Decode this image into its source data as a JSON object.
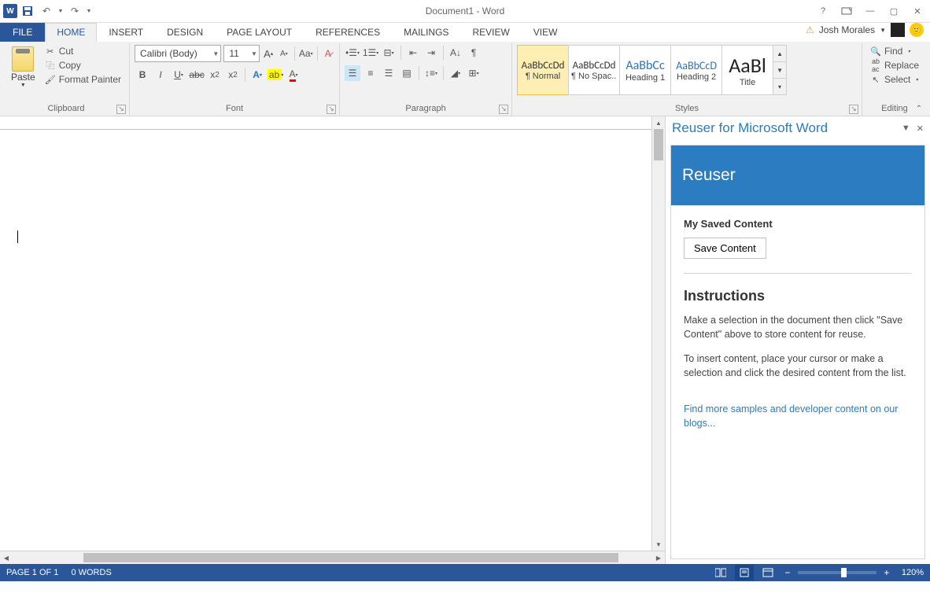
{
  "title": "Document1 - Word",
  "user": {
    "name": "Josh Morales"
  },
  "tabs": {
    "file": "FILE",
    "home": "HOME",
    "insert": "INSERT",
    "design": "DESIGN",
    "page_layout": "PAGE LAYOUT",
    "references": "REFERENCES",
    "mailings": "MAILINGS",
    "review": "REVIEW",
    "view": "VIEW"
  },
  "ribbon": {
    "clipboard": {
      "label": "Clipboard",
      "paste": "Paste",
      "cut": "Cut",
      "copy": "Copy",
      "format_painter": "Format Painter"
    },
    "font": {
      "label": "Font",
      "name": "Calibri (Body)",
      "size": "11"
    },
    "paragraph": {
      "label": "Paragraph"
    },
    "styles": {
      "label": "Styles",
      "items": [
        {
          "preview": "AaBbCcDd",
          "name": "¶ Normal",
          "color": "#333",
          "size": "13px"
        },
        {
          "preview": "AaBbCcDd",
          "name": "¶ No Spac...",
          "color": "#333",
          "size": "13px"
        },
        {
          "preview": "AaBbCc",
          "name": "Heading 1",
          "color": "#2e74b5",
          "size": "16px"
        },
        {
          "preview": "AaBbCcD",
          "name": "Heading 2",
          "color": "#2e74b5",
          "size": "14px"
        },
        {
          "preview": "AaBl",
          "name": "Title",
          "color": "#222",
          "size": "26px"
        }
      ]
    },
    "editing": {
      "label": "Editing",
      "find": "Find",
      "replace": "Replace",
      "select": "Select"
    }
  },
  "pane": {
    "title": "Reuser for Microsoft Word",
    "banner": "Reuser",
    "section": "My Saved Content",
    "save_btn": "Save Content",
    "instr_heading": "Instructions",
    "instr1": "Make a selection in the document then click \"Save Content\" above to store content for reuse.",
    "instr2": "To insert content, place your cursor or make a selection and click the desired content from the list.",
    "link": "Find more samples and developer content on our blogs..."
  },
  "status": {
    "page": "PAGE 1 OF 1",
    "words": "0 WORDS",
    "zoom": "120%"
  }
}
